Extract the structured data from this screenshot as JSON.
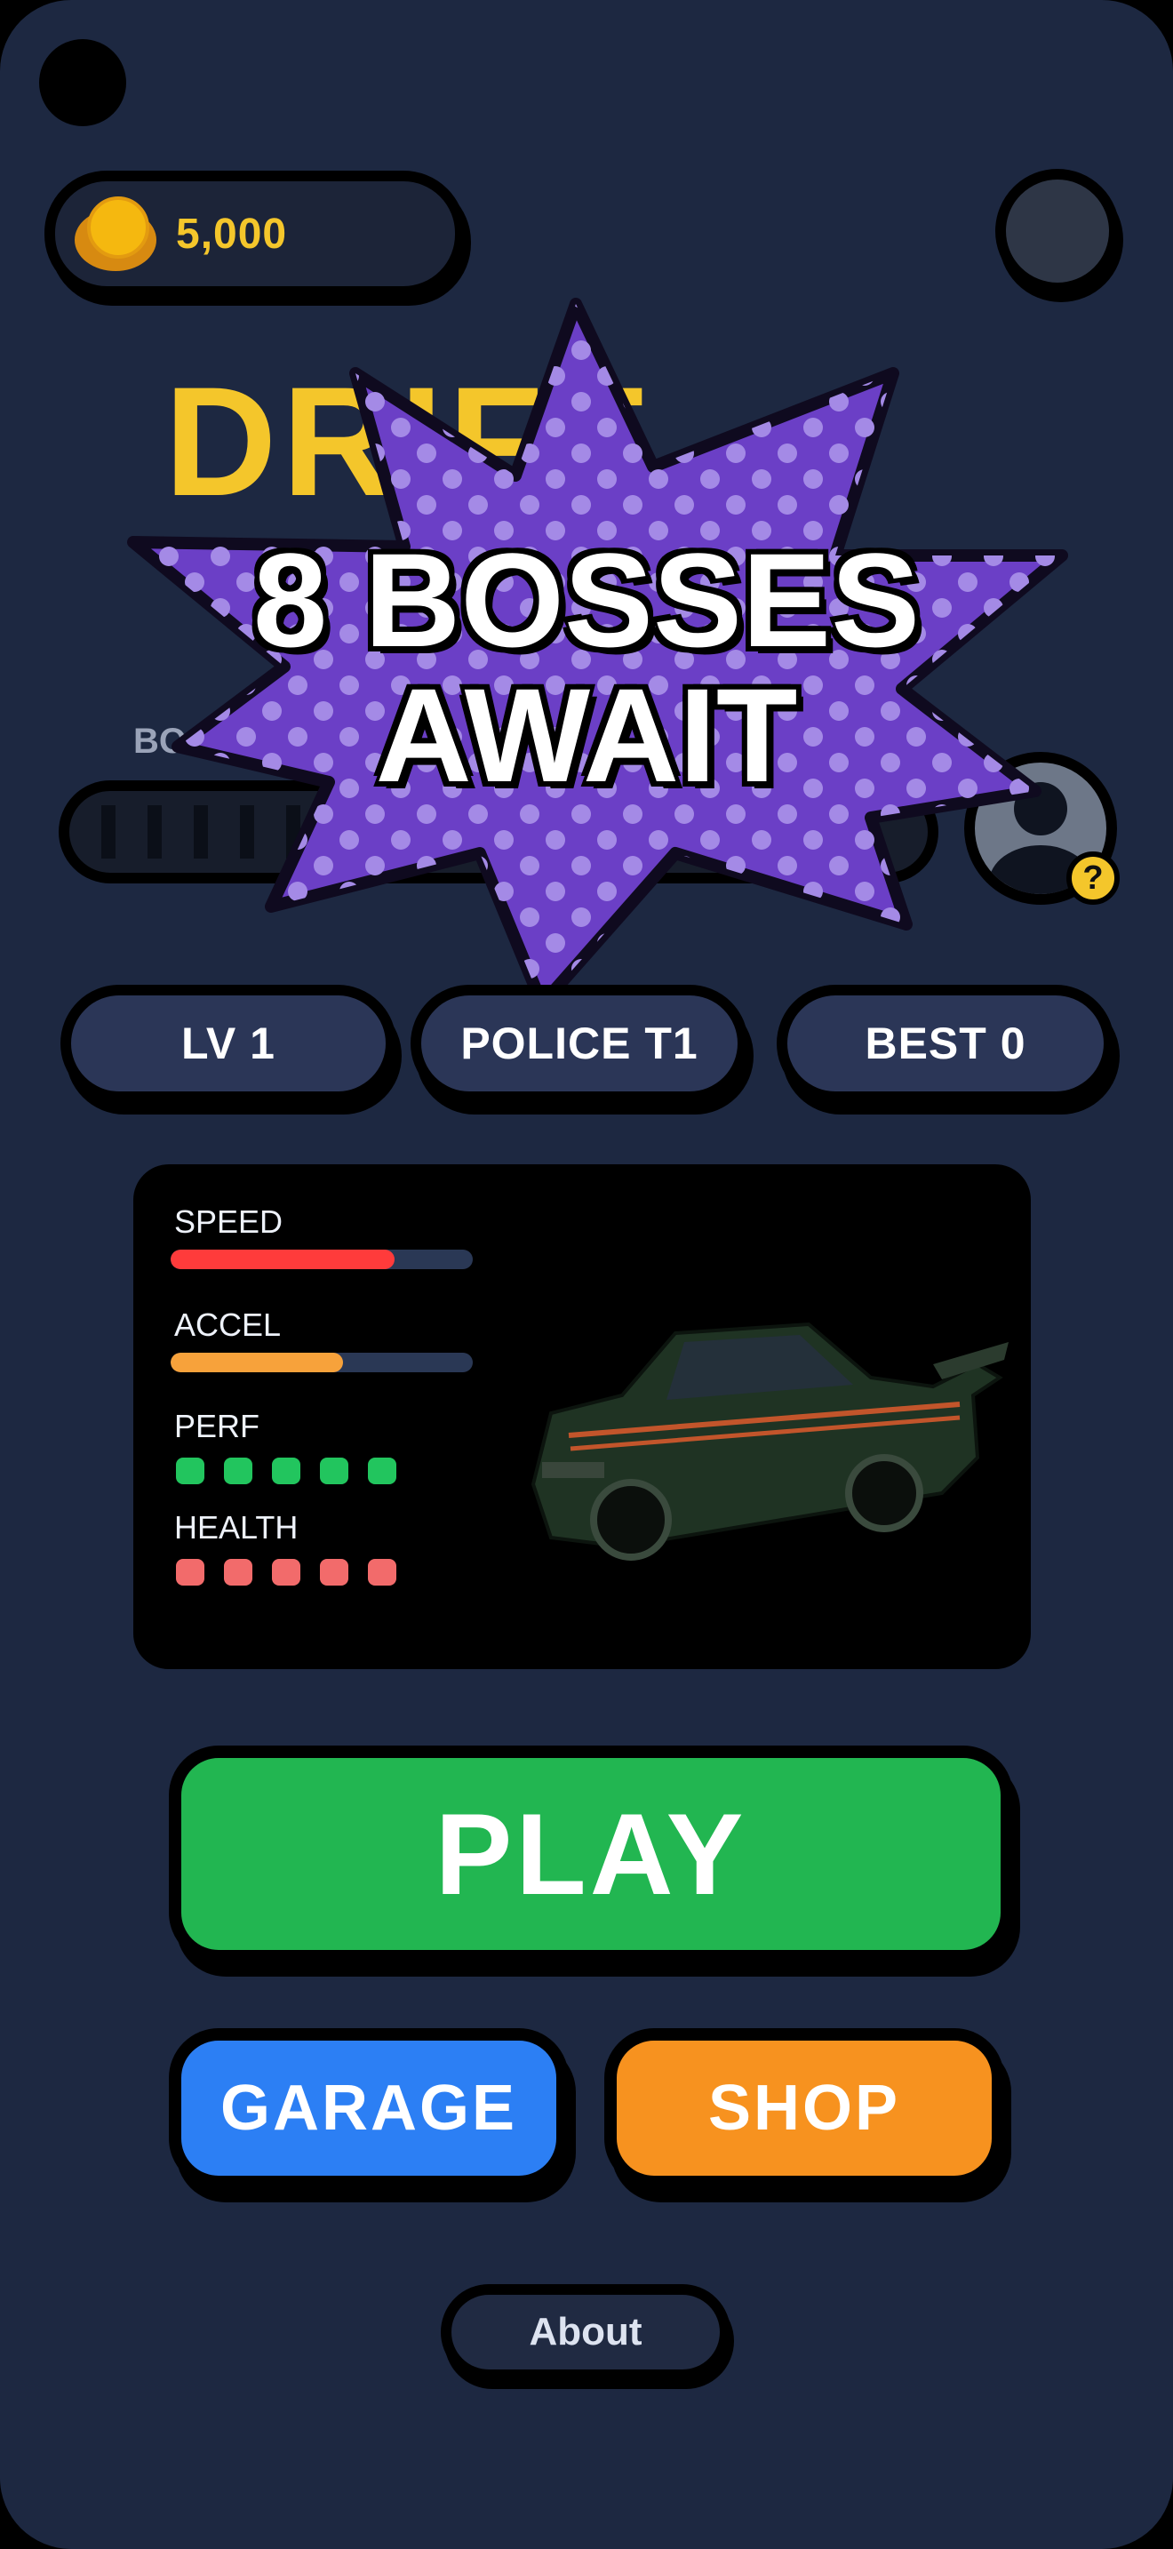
{
  "coins": {
    "value": "5,000",
    "icon": "coin-stack-icon"
  },
  "title": {
    "partial_text": "DRIFT"
  },
  "boost": {
    "label": "BOOST",
    "level": 0
  },
  "promo": {
    "line1": "8 BOSSES",
    "line2": "AWAIT",
    "burst_color": "#6b3fc6"
  },
  "help_badge": "?",
  "stats_row": {
    "level": "LV 1",
    "car": "POLICE T1",
    "best": "BEST 0"
  },
  "car_card": {
    "speed": {
      "label": "SPEED",
      "fraction": 0.74,
      "color": "#ff3b3b"
    },
    "accel": {
      "label": "ACCEL",
      "fraction": 0.57,
      "color": "#f7a23b"
    },
    "perf": {
      "label": "PERF",
      "filled": 5,
      "total": 5,
      "color": "#22c55e"
    },
    "health": {
      "label": "HEALTH",
      "filled": 5,
      "total": 5,
      "color": "#f26b6b"
    }
  },
  "buttons": {
    "play": "PLAY",
    "garage": "GARAGE",
    "shop": "SHOP",
    "about": "About"
  },
  "colors": {
    "background": "#1d2841",
    "accent_yellow": "#f4c62b",
    "play": "#22b651",
    "garage": "#2c7ff4",
    "shop": "#f7921f"
  }
}
